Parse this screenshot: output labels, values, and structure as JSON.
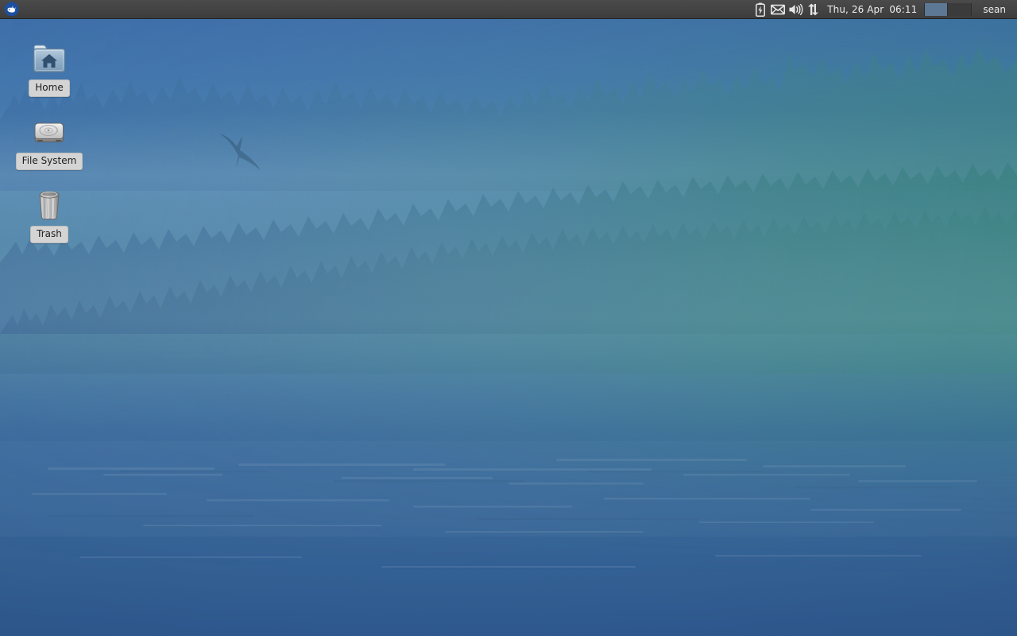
{
  "panel": {
    "menu_button": {
      "icon": "xfce-whisker-mouse-icon",
      "tooltip": "Applications"
    },
    "tray": [
      {
        "name": "battery-icon",
        "label": "Battery charging"
      },
      {
        "name": "mail-icon",
        "label": "Mail notification"
      },
      {
        "name": "volume-icon",
        "label": "Volume"
      },
      {
        "name": "network-icon",
        "label": "Network up/down"
      }
    ],
    "clock": {
      "date": "Thu, 26 Apr",
      "time": "06:11"
    },
    "workspaces": [
      {
        "name": "workspace-1",
        "active": true
      },
      {
        "name": "workspace-2",
        "active": false
      }
    ],
    "username": "sean",
    "colors": {
      "background": "#434343",
      "text": "#ededed",
      "workspace_active": "#5c7894",
      "workspace_inactive": "#3b3b3b"
    }
  },
  "desktop": {
    "icons": [
      {
        "id": "home",
        "label": "Home",
        "icon": "folder-home-icon"
      },
      {
        "id": "filesystem",
        "label": "File System",
        "icon": "hard-drive-icon"
      },
      {
        "id": "trash",
        "label": "Trash",
        "icon": "trash-bin-icon"
      }
    ],
    "wallpaper": {
      "name": "misty-pine-forest-lake",
      "colors": {
        "sky_blue": "#3e6da8",
        "mid_teal": "#4a80a3",
        "water_blue": "#2f5a91",
        "forest_far": "#3c6f94",
        "forest_near": "#3a6c84"
      }
    }
  }
}
